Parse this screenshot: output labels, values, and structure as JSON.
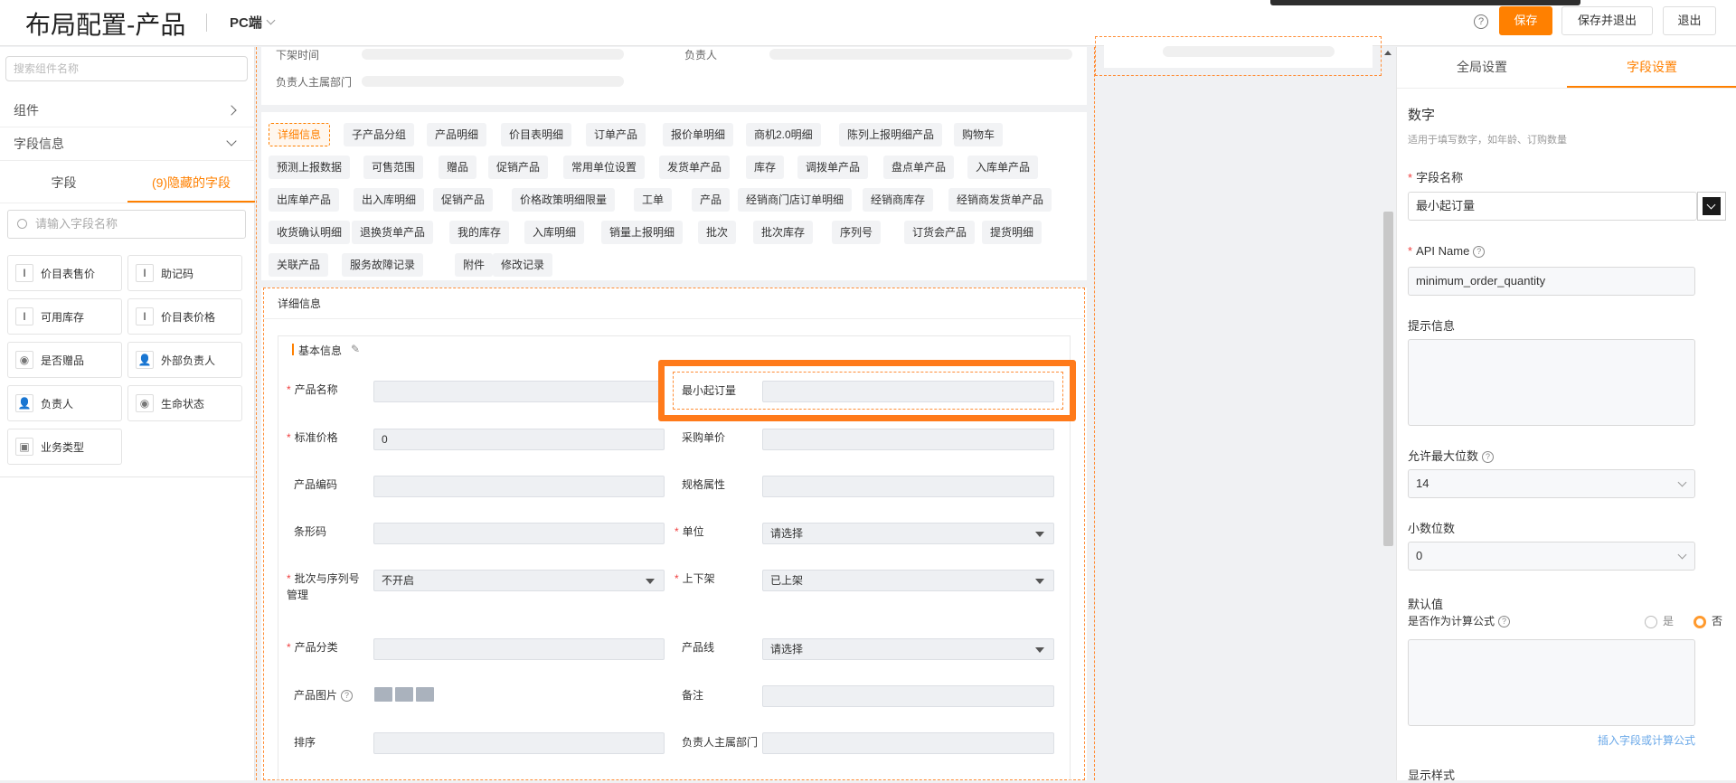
{
  "header": {
    "title": "布局配置-产品",
    "device": "PC端",
    "help_icon": "?",
    "buttons": {
      "save": "保存",
      "save_exit": "保存并退出",
      "exit": "退出"
    }
  },
  "left": {
    "search_placeholder": "搜索组件名称",
    "sections": {
      "components": "组件",
      "field_info": "字段信息"
    },
    "tabs": {
      "fields": "字段",
      "hidden": "(9)隐藏的字段"
    },
    "field_search_placeholder": "请输入字段名称",
    "chips": [
      {
        "label": "价目表售价",
        "icon": "I"
      },
      {
        "label": "助记码",
        "icon": "I"
      },
      {
        "label": "可用库存",
        "icon": "I"
      },
      {
        "label": "价目表价格",
        "icon": "I"
      },
      {
        "label": "是否赠品",
        "icon": "◉"
      },
      {
        "label": "外部负责人",
        "icon": "👤"
      },
      {
        "label": "负责人",
        "icon": "👤"
      },
      {
        "label": "生命状态",
        "icon": "◉"
      },
      {
        "label": "业务类型",
        "icon": "▣"
      }
    ]
  },
  "top_card": {
    "off_time": "下架时间",
    "owner": "负责人",
    "owner_dept": "负责人主属部门"
  },
  "tags": [
    "详细信息",
    "子产品分组",
    "产品明细",
    "价目表明细",
    "订单产品",
    "报价单明细",
    "商机2.0明细",
    "陈列上报明细产品",
    "购物车",
    "预测上报数据",
    "可售范围",
    "赠品",
    "促销产品",
    "常用单位设置",
    "发货单产品",
    "库存",
    "调拨单产品",
    "盘点单产品",
    "入库单产品",
    "出库单产品",
    "出入库明细",
    "促销产品",
    "价格政策明细限量",
    "工单",
    "产品",
    "经销商门店订单明细",
    "经销商库存",
    "经销商发货单产品",
    "收货确认明细",
    "退换货单产品",
    "我的库存",
    "入库明细",
    "销量上报明细",
    "批次",
    "批次库存",
    "序列号",
    "订货会产品",
    "提货明细",
    "关联产品",
    "服务故障记录",
    "附件",
    "修改记录"
  ],
  "detail": {
    "section_title": "详细信息",
    "group_title": "基本信息",
    "fields": {
      "product_name": "产品名称",
      "min_order": "最小起订量",
      "std_price": "标准价格",
      "std_price_value": "0",
      "purchase_price": "采购单价",
      "product_code": "产品编码",
      "spec": "规格属性",
      "barcode": "条形码",
      "unit": "单位",
      "unit_value": "请选择",
      "batch": "批次与序列号管理",
      "batch_value": "不开启",
      "shelf": "上下架",
      "shelf_value": "已上架",
      "category": "产品分类",
      "product_line": "产品线",
      "product_line_value": "请选择",
      "product_image": "产品图片",
      "remark": "备注",
      "sort": "排序",
      "owner_dept": "负责人主属部门"
    }
  },
  "right": {
    "tabs": {
      "global": "全局设置",
      "field": "字段设置"
    },
    "type_title": "数字",
    "type_desc": "适用于填写数字，如年龄、订购数量",
    "field_name_label": "字段名称",
    "field_name_value": "最小起订量",
    "api_label": "API Name",
    "api_value": "minimum_order_quantity",
    "hint_label": "提示信息",
    "max_digits_label": "允许最大位数",
    "max_digits_value": "14",
    "decimals_label": "小数位数",
    "decimals_value": "0",
    "default_label": "默认值",
    "formula_label": "是否作为计算公式",
    "yes": "是",
    "no": "否",
    "insert_link": "插入字段或计算公式",
    "display_style": "显示样式"
  }
}
